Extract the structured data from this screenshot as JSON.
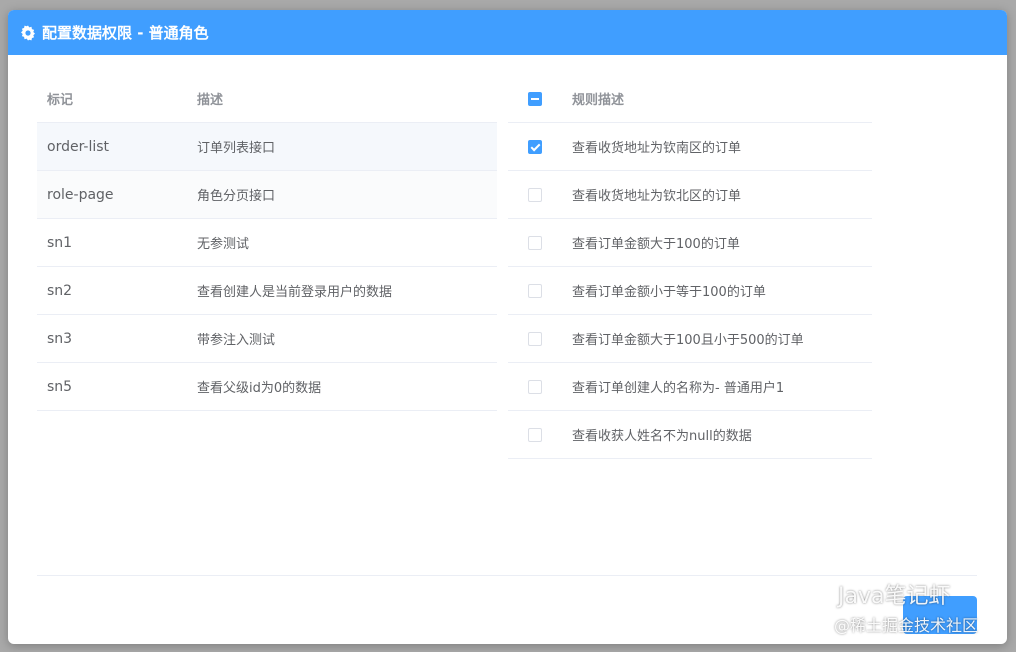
{
  "dialog": {
    "title": "配置数据权限 - 普通角色",
    "accent_color": "#409eff"
  },
  "left_table": {
    "headers": {
      "tag": "标记",
      "desc": "描述"
    },
    "rows": [
      {
        "tag": "order-list",
        "desc": "订单列表接口"
      },
      {
        "tag": "role-page",
        "desc": "角色分页接口"
      },
      {
        "tag": "sn1",
        "desc": "无参测试"
      },
      {
        "tag": "sn2",
        "desc": "查看创建人是当前登录用户的数据"
      },
      {
        "tag": "sn3",
        "desc": "带参注入测试"
      },
      {
        "tag": "sn5",
        "desc": "查看父级id为0的数据"
      }
    ]
  },
  "right_table": {
    "headers": {
      "rule": "规则描述"
    },
    "header_checkbox_state": "indeterminate",
    "rows": [
      {
        "checked": true,
        "rule": "查看收货地址为钦南区的订单"
      },
      {
        "checked": false,
        "rule": "查看收货地址为钦北区的订单"
      },
      {
        "checked": false,
        "rule": "查看订单金额大于100的订单"
      },
      {
        "checked": false,
        "rule": "查看订单金额小于等于100的订单"
      },
      {
        "checked": false,
        "rule": "查看订单金额大于100且小于500的订单"
      },
      {
        "checked": false,
        "rule": "查看订单创建人的名称为- 普通用户1"
      },
      {
        "checked": false,
        "rule": "查看收获人姓名不为null的数据"
      }
    ]
  },
  "watermark": {
    "line1": "Java笔记虾",
    "line2": "@稀土掘金技术社区",
    "icon": "wechat-icon"
  }
}
